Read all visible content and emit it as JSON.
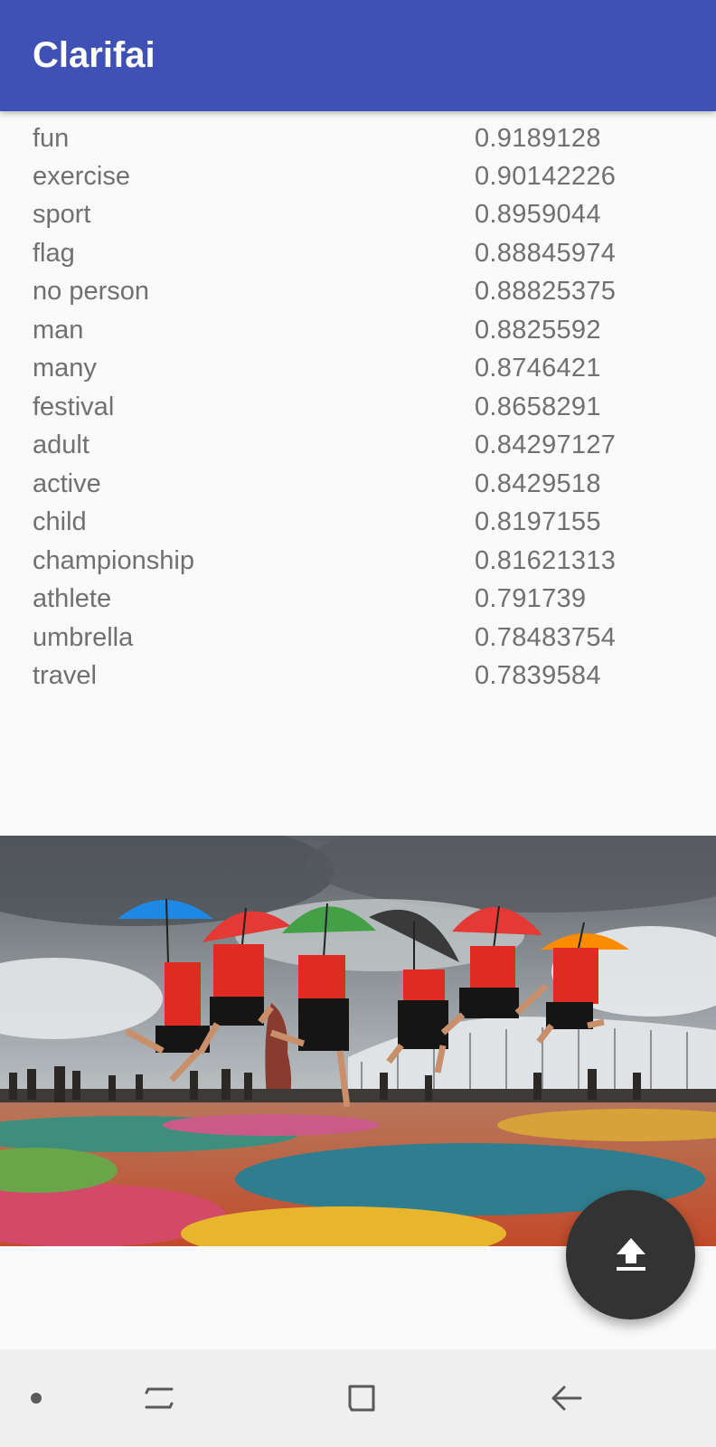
{
  "app_bar": {
    "title": "Clarifai",
    "color": "#3f51b5"
  },
  "results": [
    {
      "name": "fun",
      "score": "0.9189128"
    },
    {
      "name": "exercise",
      "score": "0.90142226"
    },
    {
      "name": "sport",
      "score": "0.8959044"
    },
    {
      "name": "flag",
      "score": "0.88845974"
    },
    {
      "name": "no person",
      "score": "0.88825375"
    },
    {
      "name": "man",
      "score": "0.8825592"
    },
    {
      "name": "many",
      "score": "0.8746421"
    },
    {
      "name": "festival",
      "score": "0.8658291"
    },
    {
      "name": "adult",
      "score": "0.84297127"
    },
    {
      "name": "active",
      "score": "0.8429518"
    },
    {
      "name": "child",
      "score": "0.8197155"
    },
    {
      "name": "championship",
      "score": "0.81621313"
    },
    {
      "name": "athlete",
      "score": "0.791739"
    },
    {
      "name": "umbrella",
      "score": "0.78483754"
    },
    {
      "name": "travel",
      "score": "0.7839584"
    }
  ],
  "photo": {
    "subject": "people with colorful umbrellas jumping in front of stadium",
    "umbrella_colors": [
      "#1e88e5",
      "#e53935",
      "#43a047",
      "#424242",
      "#e53935",
      "#fb8c00"
    ]
  },
  "fab": {
    "icon": "upload-icon"
  },
  "nav_bar": {
    "items": [
      "dot-icon",
      "recent-apps-icon",
      "home-icon",
      "back-icon"
    ]
  }
}
